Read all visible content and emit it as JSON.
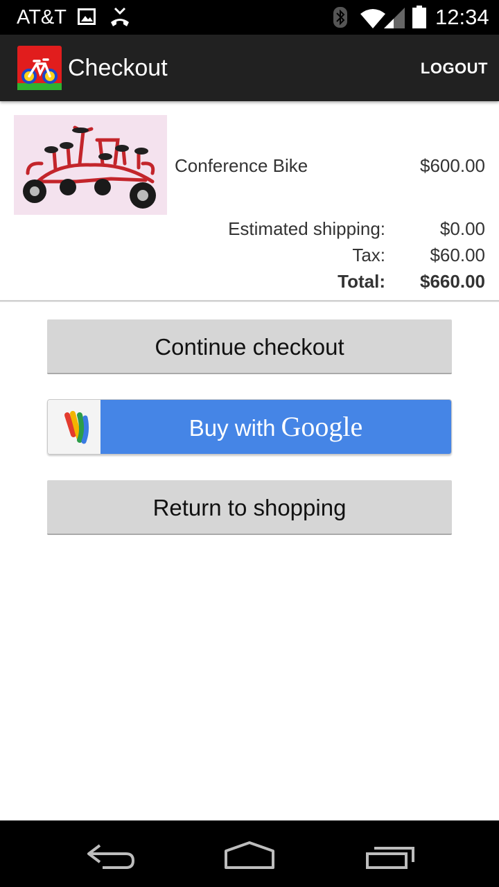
{
  "status_bar": {
    "carrier": "AT&T",
    "time": "12:34",
    "icons": [
      "image-icon",
      "call-icon",
      "bluetooth-icon",
      "wifi-icon",
      "signal-icon",
      "battery-icon"
    ]
  },
  "app_bar": {
    "title": "Checkout",
    "logout_label": "LOGOUT",
    "logo_icon": "bike-logo-icon"
  },
  "cart": {
    "item": {
      "name": "Conference Bike",
      "price": "$600.00",
      "image": "conference-bike-image"
    },
    "summary": [
      {
        "label": "Estimated shipping:",
        "value": "$0.00"
      },
      {
        "label": "Tax:",
        "value": "$60.00"
      },
      {
        "label": "Total:",
        "value": "$660.00"
      }
    ]
  },
  "actions": {
    "continue_label": "Continue checkout",
    "google_buy_text": "Buy with",
    "google_brand": "Google",
    "return_label": "Return to shopping"
  },
  "nav_bar": {
    "icons": [
      "back-icon",
      "home-icon",
      "recents-icon"
    ]
  },
  "colors": {
    "app_bar": "#212121",
    "google_button": "#4585e6",
    "button_gray": "#d6d6d6"
  }
}
